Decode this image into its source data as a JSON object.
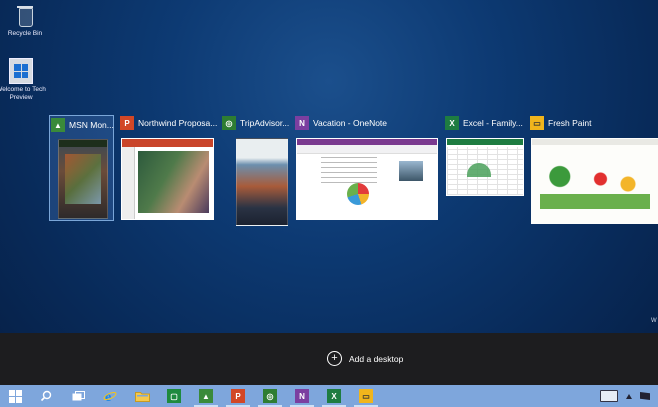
{
  "desktop": {
    "icons": [
      {
        "label": "Recycle Bin",
        "icon": "recycle-bin-icon"
      },
      {
        "label": "Welcome to Tech Preview",
        "icon": "windows-logo-icon"
      }
    ],
    "side_text": "W"
  },
  "task_view": {
    "windows": [
      {
        "title": "MSN Mon...",
        "app_glyph": "▲",
        "color": "#3a8a3a",
        "selected": true
      },
      {
        "title": "Northwind Proposa...",
        "app_glyph": "P",
        "color": "#d24726",
        "selected": false
      },
      {
        "title": "TripAdvisor...",
        "app_glyph": "◎",
        "color": "#2e7d32",
        "selected": false
      },
      {
        "title": "Vacation - OneNote",
        "app_glyph": "N",
        "color": "#7b3fa0",
        "selected": false
      },
      {
        "title": "Excel - Family...",
        "app_glyph": "X",
        "color": "#1e7c41",
        "selected": false
      },
      {
        "title": "Fresh Paint",
        "app_glyph": "▭",
        "color": "#f1b51c",
        "selected": false
      }
    ],
    "add_desktop_label": "Add a desktop"
  },
  "taskbar": {
    "buttons": [
      {
        "name": "start-button",
        "icon": "windows-logo-icon"
      },
      {
        "name": "search-button",
        "icon": "search-icon"
      },
      {
        "name": "task-view-button",
        "icon": "task-view-icon"
      },
      {
        "name": "internet-explorer-button",
        "icon": "ie-icon"
      },
      {
        "name": "file-explorer-button",
        "icon": "folder-icon"
      }
    ],
    "apps": [
      {
        "glyph": "▢",
        "color": "#1e8a3e"
      },
      {
        "glyph": "▲",
        "color": "#3a8a3a"
      },
      {
        "glyph": "P",
        "color": "#d24726"
      },
      {
        "glyph": "◎",
        "color": "#2e7d32"
      },
      {
        "glyph": "N",
        "color": "#7b3fa0"
      },
      {
        "glyph": "X",
        "color": "#1e7c41"
      },
      {
        "glyph": "▭",
        "color": "#f1b51c"
      }
    ],
    "tray_icons": [
      "keyboard-icon",
      "up-arrow-icon",
      "flag-icon"
    ]
  }
}
